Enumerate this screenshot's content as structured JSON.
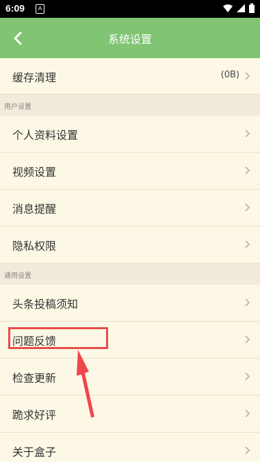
{
  "status_bar": {
    "time": "6:09",
    "badge": "A"
  },
  "header": {
    "title": "系统设置"
  },
  "cache": {
    "label": "缓存清理",
    "value": "(0B)"
  },
  "sections": {
    "user": {
      "title": "用户设置",
      "items": [
        {
          "label": "个人资料设置"
        },
        {
          "label": "视频设置"
        },
        {
          "label": "消息提醒"
        },
        {
          "label": "隐私权限"
        }
      ]
    },
    "general": {
      "title": "通用设置",
      "items": [
        {
          "label": "头条投稿须知"
        },
        {
          "label": "问题反馈"
        },
        {
          "label": "检查更新"
        },
        {
          "label": "跪求好评"
        },
        {
          "label": "关于盒子"
        }
      ]
    }
  },
  "colors": {
    "header_bg": "#80c474",
    "highlight": "#e84a4a",
    "background": "#fdf8e6"
  },
  "icons": [
    "back-arrow-icon",
    "chevron-right-icon",
    "wifi-icon",
    "signal-icon",
    "battery-icon"
  ]
}
